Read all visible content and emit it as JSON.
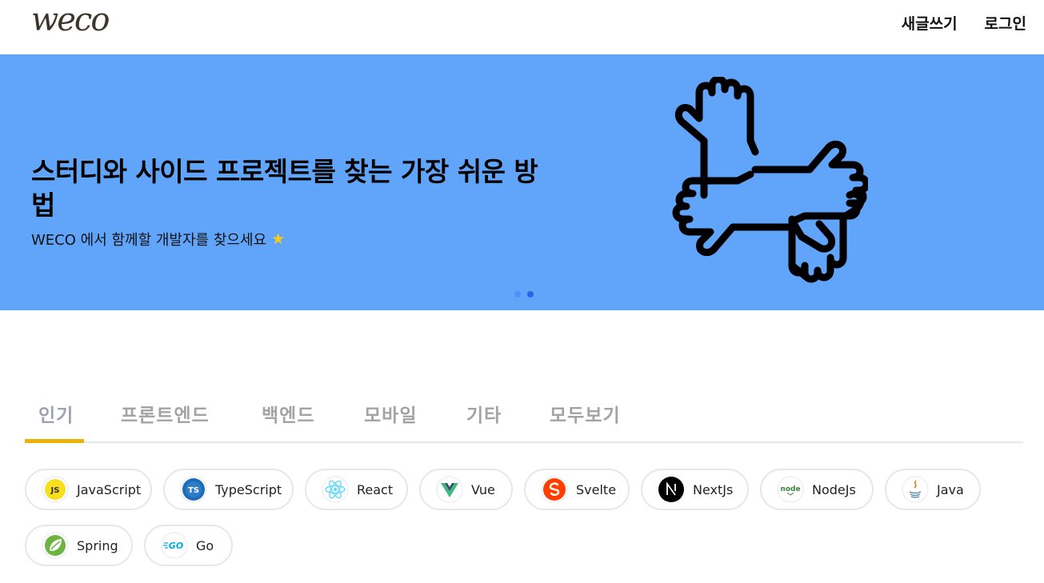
{
  "header": {
    "logo": "weco",
    "nav": [
      "새글쓰기",
      "로그인"
    ]
  },
  "banner": {
    "title": "스터디와 사이드 프로젝트를 찾는 가장 쉬운 방법",
    "subtitle": "WECO 에서 함께할 개발자를 찾으세요",
    "star_icon": "star-icon",
    "illustration": "hands-together-icon",
    "bg_color": "#60a5fa",
    "slides_total": 2,
    "active_slide": 2
  },
  "tabs": {
    "items": [
      "인기",
      "프론트엔드",
      "백엔드",
      "모바일",
      "기타",
      "모두보기"
    ],
    "active": "인기",
    "accent": "#eab308"
  },
  "stacks": [
    {
      "label": "JavaScript",
      "icon": "javascript-icon"
    },
    {
      "label": "TypeScript",
      "icon": "typescript-icon"
    },
    {
      "label": "React",
      "icon": "react-icon"
    },
    {
      "label": "Vue",
      "icon": "vue-icon"
    },
    {
      "label": "Svelte",
      "icon": "svelte-icon"
    },
    {
      "label": "NextJs",
      "icon": "nextjs-icon"
    },
    {
      "label": "NodeJs",
      "icon": "nodejs-icon"
    },
    {
      "label": "Java",
      "icon": "java-icon"
    },
    {
      "label": "Spring",
      "icon": "spring-icon"
    },
    {
      "label": "Go",
      "icon": "go-icon"
    }
  ]
}
